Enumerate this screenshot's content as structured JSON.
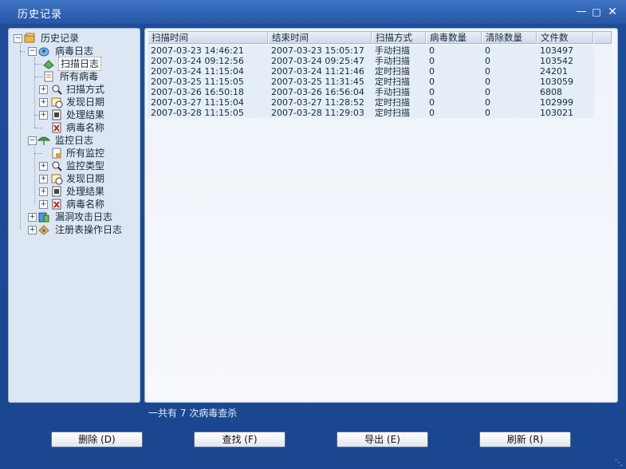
{
  "window": {
    "title": "历史记录"
  },
  "tree": {
    "root": "历史记录",
    "virus_log": "病毒日志",
    "scan_log": "扫描日志",
    "all_virus": "所有病毒",
    "scan_mode": "扫描方式",
    "found_date": "发现日期",
    "result": "处理结果",
    "virus_name": "病毒名称",
    "monitor_log": "监控日志",
    "all_monitor": "所有监控",
    "monitor_type": "监控类型",
    "m_found_date": "发现日期",
    "m_result": "处理结果",
    "m_virus_name": "病毒名称",
    "exploit_log": "漏洞攻击日志",
    "registry_log": "注册表操作日志"
  },
  "table": {
    "columns": [
      "扫描时间",
      "结束时间",
      "扫描方式",
      "病毒数量",
      "清除数量",
      "文件数"
    ],
    "rows": [
      [
        "2007-03-23 14:46:21",
        "2007-03-23 15:05:17",
        "手动扫描",
        "0",
        "0",
        "103497"
      ],
      [
        "2007-03-24 09:12:56",
        "2007-03-24 09:25:47",
        "手动扫描",
        "0",
        "0",
        "103542"
      ],
      [
        "2007-03-24 11:15:04",
        "2007-03-24 11:21:46",
        "定时扫描",
        "0",
        "0",
        "24201"
      ],
      [
        "2007-03-25 11:15:05",
        "2007-03-25 11:31:45",
        "定时扫描",
        "0",
        "0",
        "103059"
      ],
      [
        "2007-03-26 16:50:18",
        "2007-03-26 16:56:04",
        "手动扫描",
        "0",
        "0",
        "6808"
      ],
      [
        "2007-03-27 11:15:04",
        "2007-03-27 11:28:52",
        "定时扫描",
        "0",
        "0",
        "102999"
      ],
      [
        "2007-03-28 11:15:05",
        "2007-03-28 11:29:03",
        "定时扫描",
        "0",
        "0",
        "103021"
      ]
    ]
  },
  "status": "一共有 7 次病毒查杀",
  "buttons": {
    "delete": "删除 (D)",
    "find": "查找 (F)",
    "export": "导出 (E)",
    "refresh": "刷新 (R)"
  }
}
